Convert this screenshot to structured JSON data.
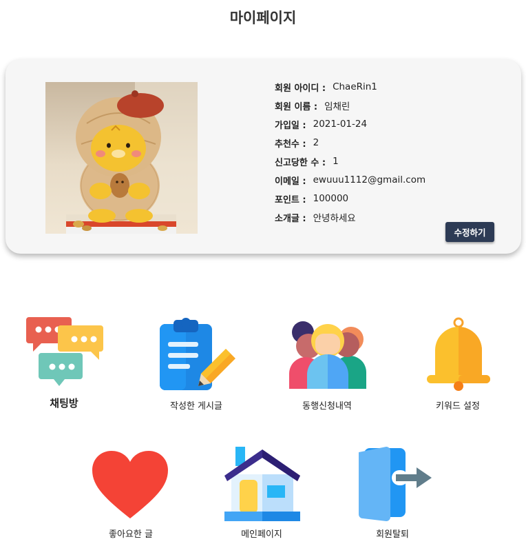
{
  "page": {
    "title": "마이페이지"
  },
  "profile": {
    "rows": [
      {
        "label": "회원 아이디 :",
        "value": "ChaeRin1"
      },
      {
        "label": "회원 이름 :",
        "value": "임채린"
      },
      {
        "label": "가입일 :",
        "value": "2021-01-24"
      },
      {
        "label": "추천수 :",
        "value": "2"
      },
      {
        "label": "신고당한 수 :",
        "value": "1"
      },
      {
        "label": "이메일 :",
        "value": "ewuuu1112@gmail.com"
      },
      {
        "label": "포인트 :",
        "value": "100000"
      },
      {
        "label": "소개글 :",
        "value": "안녕하세요"
      }
    ],
    "edit_label": "수정하기"
  },
  "menu": {
    "chat": "채팅방",
    "posts": "작성한 게시글",
    "companions": "동행신청내역",
    "keywords": "키워드 설정",
    "likes": "좋아요한 글",
    "main": "메인페이지",
    "withdraw": "회원탈퇴"
  },
  "colors": {
    "edit_button": "#2d3b55",
    "card_background": "#f6f6f6",
    "heart": "#f44336"
  },
  "icons": [
    "chat-bubbles-icon",
    "clipboard-pencil-icon",
    "group-people-icon",
    "bell-icon",
    "heart-icon",
    "house-icon",
    "exit-door-icon"
  ]
}
